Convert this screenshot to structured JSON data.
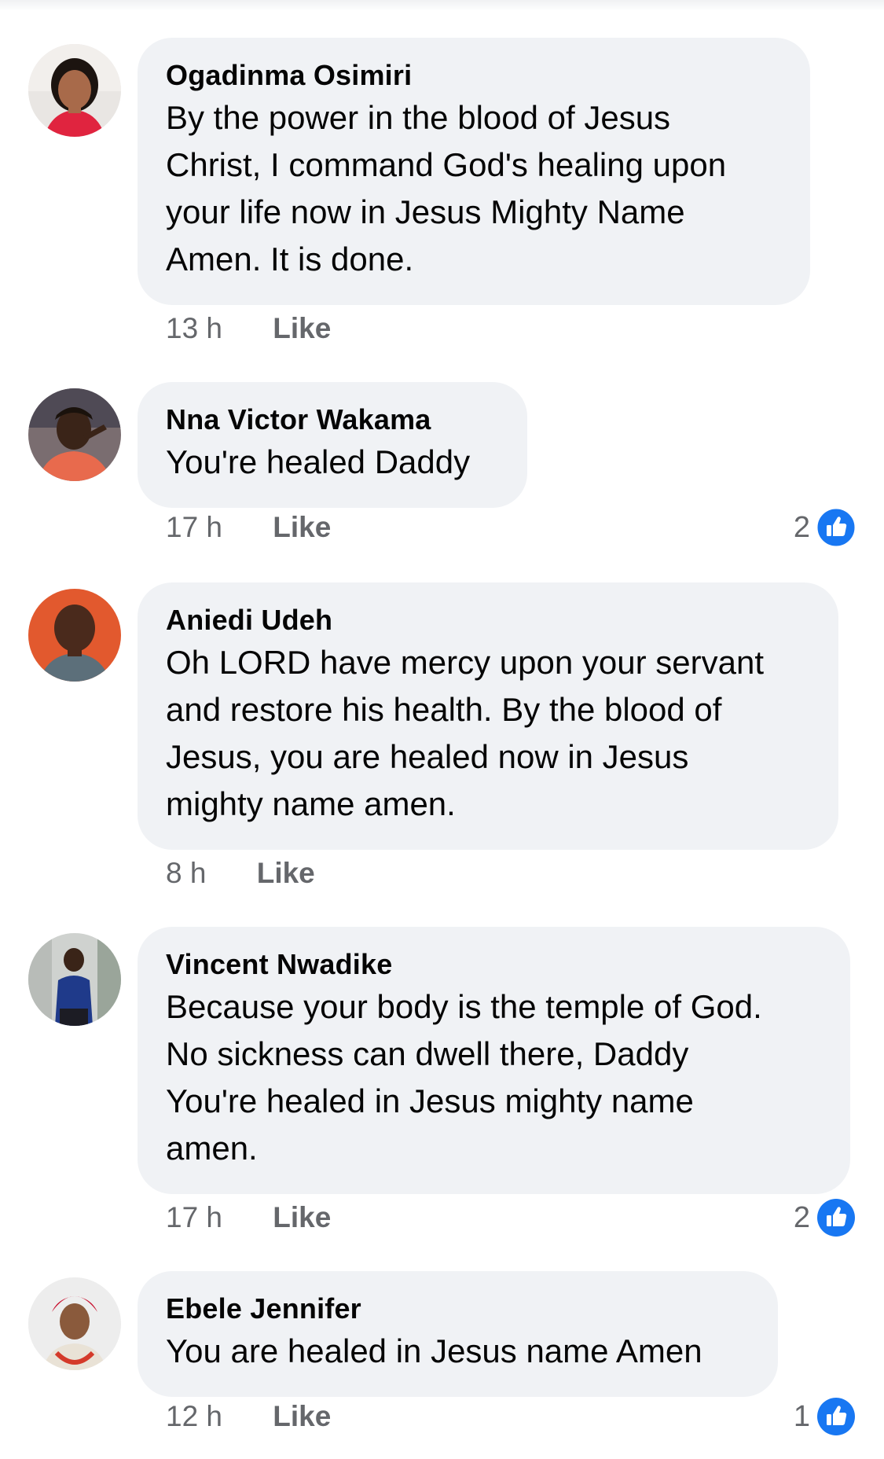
{
  "comments": [
    {
      "author": "Ogadinma Osimiri",
      "text": "By the power in the blood of Jesus\nChrist, I command God's healing upon\nyour life now in Jesus Mighty Name\nAmen. It is done.",
      "time": "13 h",
      "like_label": "Like",
      "reactions": null
    },
    {
      "author": "Nna Victor Wakama",
      "text": "You're healed Daddy",
      "time": "17 h",
      "like_label": "Like",
      "reactions": "2"
    },
    {
      "author": "Aniedi Udeh",
      "text": "Oh LORD have mercy upon your servant\nand restore his health.  By the blood of\nJesus, you are healed now in Jesus\nmighty name amen.",
      "time": "8 h",
      "like_label": "Like",
      "reactions": null
    },
    {
      "author": "Vincent Nwadike",
      "text": "Because your body is the temple of God.\nNo sickness can dwell there, Daddy\nYou're healed in Jesus mighty name\namen.",
      "time": "17 h",
      "like_label": "Like",
      "reactions": "2"
    },
    {
      "author": "Ebele Jennifer",
      "text": "You are healed in Jesus name Amen",
      "time": "12 h",
      "like_label": "Like",
      "reactions": "1"
    }
  ],
  "colors": {
    "bubble": "#f0f2f5",
    "meta_text": "#65676b",
    "like_blue": "#1877f2"
  },
  "icons": {
    "reaction": "thumbs-up-icon"
  }
}
